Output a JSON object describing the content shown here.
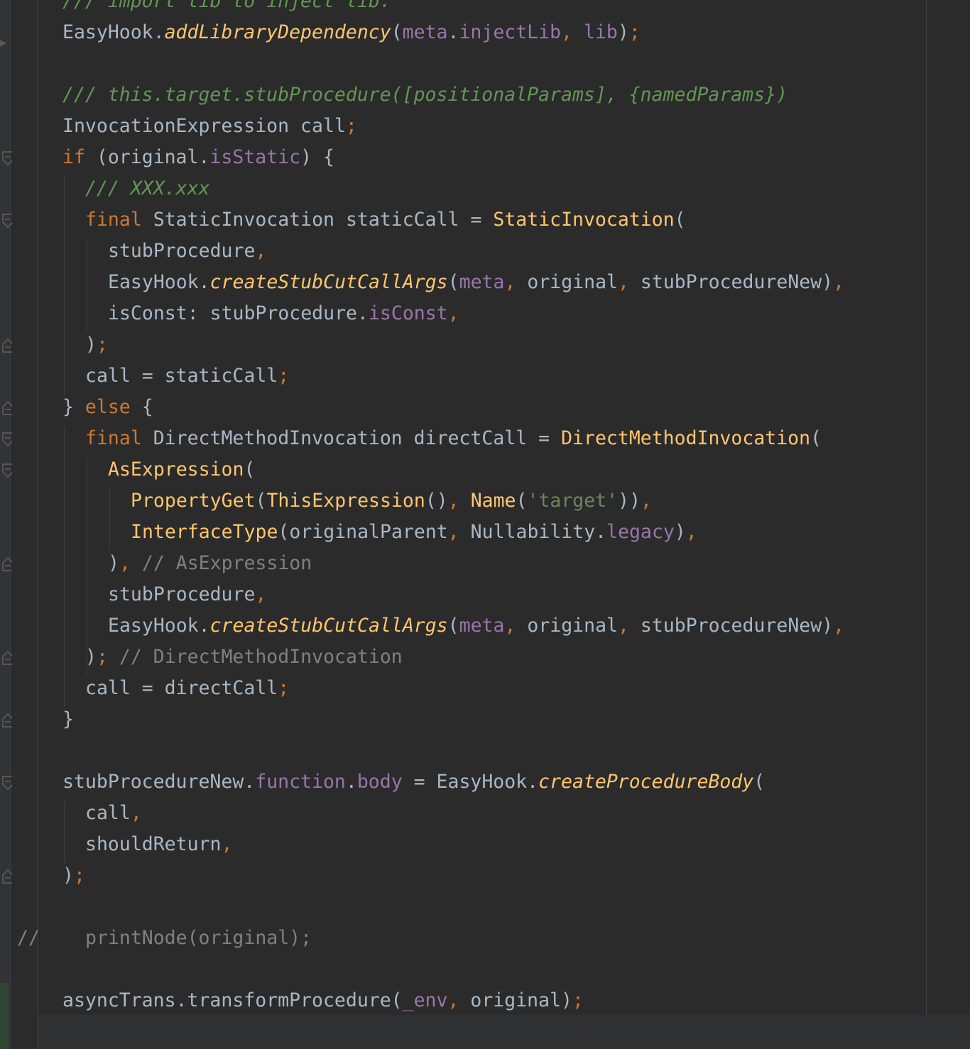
{
  "editor": {
    "language": "Dart",
    "lines": [
      {
        "indent": 0,
        "tokens": [
          [
            "dc",
            "/// import lib to inject lib."
          ]
        ]
      },
      {
        "indent": 0,
        "tokens": [
          [
            "t",
            "EasyHook."
          ],
          [
            "fi",
            "addLibraryDependency"
          ],
          [
            "t",
            "("
          ],
          [
            "m",
            "meta"
          ],
          [
            "t",
            "."
          ],
          [
            "m",
            "injectLib"
          ],
          [
            "p",
            ", "
          ],
          [
            "m",
            "lib"
          ],
          [
            "t",
            ")"
          ],
          [
            "p",
            ";"
          ]
        ]
      },
      {
        "indent": 0,
        "tokens": []
      },
      {
        "indent": 0,
        "tokens": [
          [
            "dc",
            "/// this.target.stubProcedure([positionalParams], {namedParams})"
          ]
        ]
      },
      {
        "indent": 0,
        "tokens": [
          [
            "t",
            "InvocationExpression call"
          ],
          [
            "p",
            ";"
          ]
        ]
      },
      {
        "indent": 0,
        "tokens": [
          [
            "k",
            "if "
          ],
          [
            "t",
            "(original."
          ],
          [
            "m",
            "isStatic"
          ],
          [
            "t",
            ") {"
          ]
        ]
      },
      {
        "indent": 1,
        "tokens": [
          [
            "dc",
            "/// XXX.xxx"
          ]
        ]
      },
      {
        "indent": 1,
        "tokens": [
          [
            "k",
            "final "
          ],
          [
            "t",
            "StaticInvocation staticCall = "
          ],
          [
            "f",
            "StaticInvocation"
          ],
          [
            "t",
            "("
          ]
        ]
      },
      {
        "indent": 2,
        "tokens": [
          [
            "t",
            "stubProcedure"
          ],
          [
            "p",
            ","
          ]
        ]
      },
      {
        "indent": 2,
        "tokens": [
          [
            "t",
            "EasyHook."
          ],
          [
            "fi",
            "createStubCutCallArgs"
          ],
          [
            "t",
            "("
          ],
          [
            "m",
            "meta"
          ],
          [
            "p",
            ", "
          ],
          [
            "t",
            "original"
          ],
          [
            "p",
            ", "
          ],
          [
            "t",
            "stubProcedureNew)"
          ],
          [
            "p",
            ","
          ]
        ]
      },
      {
        "indent": 2,
        "tokens": [
          [
            "t",
            "isConst: stubProcedure."
          ],
          [
            "m",
            "isConst"
          ],
          [
            "p",
            ","
          ]
        ]
      },
      {
        "indent": 1,
        "tokens": [
          [
            "t",
            ")"
          ],
          [
            "p",
            ";"
          ]
        ]
      },
      {
        "indent": 1,
        "tokens": [
          [
            "t",
            "call = staticCall"
          ],
          [
            "p",
            ";"
          ]
        ]
      },
      {
        "indent": 0,
        "tokens": [
          [
            "t",
            "} "
          ],
          [
            "k",
            "else "
          ],
          [
            "t",
            "{"
          ]
        ]
      },
      {
        "indent": 1,
        "tokens": [
          [
            "k",
            "final "
          ],
          [
            "t",
            "DirectMethodInvocation directCall = "
          ],
          [
            "f",
            "DirectMethodInvocation"
          ],
          [
            "t",
            "("
          ]
        ]
      },
      {
        "indent": 2,
        "tokens": [
          [
            "f",
            "AsExpression"
          ],
          [
            "t",
            "("
          ]
        ]
      },
      {
        "indent": 3,
        "tokens": [
          [
            "f",
            "PropertyGet"
          ],
          [
            "t",
            "("
          ],
          [
            "f",
            "ThisExpression"
          ],
          [
            "t",
            "()"
          ],
          [
            "p",
            ", "
          ],
          [
            "f",
            "Name"
          ],
          [
            "t",
            "("
          ],
          [
            "s",
            "'target'"
          ],
          [
            "t",
            "))"
          ],
          [
            "p",
            ","
          ]
        ]
      },
      {
        "indent": 3,
        "tokens": [
          [
            "f",
            "InterfaceType"
          ],
          [
            "t",
            "(originalParent"
          ],
          [
            "p",
            ", "
          ],
          [
            "t",
            "Nullability."
          ],
          [
            "m",
            "legacy"
          ],
          [
            "t",
            ")"
          ],
          [
            "p",
            ","
          ]
        ]
      },
      {
        "indent": 2,
        "tokens": [
          [
            "t",
            ")"
          ],
          [
            "p",
            ", "
          ],
          [
            "c",
            "// AsExpression"
          ]
        ]
      },
      {
        "indent": 2,
        "tokens": [
          [
            "t",
            "stubProcedure"
          ],
          [
            "p",
            ","
          ]
        ]
      },
      {
        "indent": 2,
        "tokens": [
          [
            "t",
            "EasyHook."
          ],
          [
            "fi",
            "createStubCutCallArgs"
          ],
          [
            "t",
            "("
          ],
          [
            "m",
            "meta"
          ],
          [
            "p",
            ", "
          ],
          [
            "t",
            "original"
          ],
          [
            "p",
            ", "
          ],
          [
            "t",
            "stubProcedureNew)"
          ],
          [
            "p",
            ","
          ]
        ]
      },
      {
        "indent": 1,
        "tokens": [
          [
            "t",
            ")"
          ],
          [
            "p",
            "; "
          ],
          [
            "c",
            "// DirectMethodInvocation"
          ]
        ]
      },
      {
        "indent": 1,
        "tokens": [
          [
            "t",
            "call = directCall"
          ],
          [
            "p",
            ";"
          ]
        ]
      },
      {
        "indent": 0,
        "tokens": [
          [
            "t",
            "}"
          ]
        ]
      },
      {
        "indent": 0,
        "tokens": []
      },
      {
        "indent": 0,
        "tokens": [
          [
            "t",
            "stubProcedureNew."
          ],
          [
            "m",
            "function"
          ],
          [
            "t",
            "."
          ],
          [
            "m",
            "body"
          ],
          [
            "t",
            " = EasyHook."
          ],
          [
            "fi",
            "createProcedureBody"
          ],
          [
            "t",
            "("
          ]
        ]
      },
      {
        "indent": 1,
        "tokens": [
          [
            "t",
            "call"
          ],
          [
            "p",
            ","
          ]
        ]
      },
      {
        "indent": 1,
        "tokens": [
          [
            "t",
            "shouldReturn"
          ],
          [
            "p",
            ","
          ]
        ]
      },
      {
        "indent": 0,
        "tokens": [
          [
            "t",
            ")"
          ],
          [
            "p",
            ";"
          ]
        ]
      },
      {
        "indent": 0,
        "tokens": []
      },
      {
        "indent": 1,
        "prefix": "//",
        "tokens": [
          [
            "c",
            "printNode(original);"
          ]
        ]
      },
      {
        "indent": 0,
        "tokens": []
      },
      {
        "indent": 0,
        "tokens": [
          [
            "t",
            "asyncTrans.transformProcedure("
          ],
          [
            "m",
            "_env"
          ],
          [
            "p",
            ", "
          ],
          [
            "t",
            "original)"
          ],
          [
            "p",
            ";"
          ]
        ]
      },
      {
        "indent": 0,
        "tokens": []
      }
    ],
    "fold_markers": [
      {
        "line": 5,
        "kind": "open"
      },
      {
        "line": 7,
        "kind": "open"
      },
      {
        "line": 11,
        "kind": "close"
      },
      {
        "line": 13,
        "kind": "close"
      },
      {
        "line": 14,
        "kind": "open"
      },
      {
        "line": 15,
        "kind": "open"
      },
      {
        "line": 18,
        "kind": "close"
      },
      {
        "line": 21,
        "kind": "close"
      },
      {
        "line": 23,
        "kind": "close"
      },
      {
        "line": 25,
        "kind": "open"
      },
      {
        "line": 28,
        "kind": "close"
      }
    ]
  }
}
